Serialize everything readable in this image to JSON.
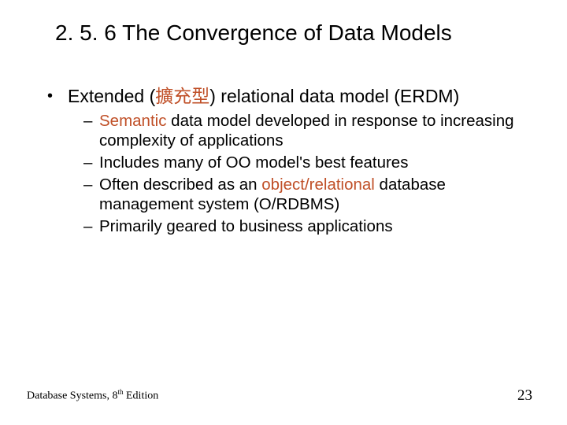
{
  "title": "2. 5. 6 The Convergence of Data Models",
  "main": {
    "lead_a": "Extended (",
    "lead_accent": "擴充型",
    "lead_b": ") relational data model (ERDM)"
  },
  "sub": [
    {
      "pre": "",
      "accent": "Semantic",
      "post": " data model developed in response to increasing complexity of applications"
    },
    {
      "pre": "Includes many of OO model's best features",
      "accent": "",
      "post": ""
    },
    {
      "pre": "Often described as an ",
      "accent": "object/relational",
      "post": " database management system (O/RDBMS)"
    },
    {
      "pre": "Primarily geared to business applications",
      "accent": "",
      "post": ""
    }
  ],
  "footer": {
    "source_a": "Database Systems, 8",
    "source_sup": "th",
    "source_b": " Edition",
    "page": "23"
  }
}
